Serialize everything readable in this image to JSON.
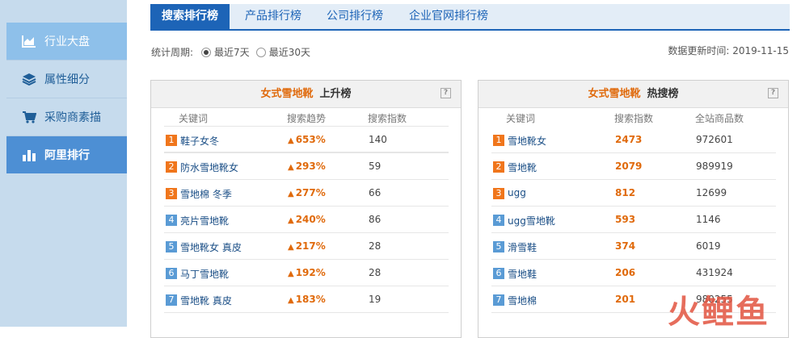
{
  "sidebar": {
    "items": [
      {
        "label": "行业大盘",
        "icon": "chart-area-icon"
      },
      {
        "label": "属性细分",
        "icon": "layers-icon"
      },
      {
        "label": "采购商素描",
        "icon": "cart-icon"
      },
      {
        "label": "阿里排行",
        "icon": "bar-chart-icon"
      }
    ]
  },
  "tabs": [
    "搜索排行榜",
    "产品排行榜",
    "公司排行榜",
    "企业官网排行榜"
  ],
  "period": {
    "label": "统计周期:",
    "options": [
      "最近7天",
      "最近30天"
    ],
    "selected": "最近7天"
  },
  "update": {
    "label": "数据更新时间:",
    "date": "2019-11-15"
  },
  "rising": {
    "category": "女式雪地靴",
    "title": "上升榜",
    "columns": [
      "关键词",
      "搜索趋势",
      "搜索指数"
    ],
    "rows": [
      {
        "rank": "1",
        "keyword": "鞋子女冬",
        "trend": "653%",
        "index": "140"
      },
      {
        "rank": "2",
        "keyword": "防水雪地靴女",
        "trend": "293%",
        "index": "59"
      },
      {
        "rank": "3",
        "keyword": "雪地棉 冬季",
        "trend": "277%",
        "index": "66"
      },
      {
        "rank": "4",
        "keyword": "亮片雪地靴",
        "trend": "240%",
        "index": "86"
      },
      {
        "rank": "5",
        "keyword": "雪地靴女 真皮",
        "trend": "217%",
        "index": "28"
      },
      {
        "rank": "6",
        "keyword": "马丁雪地靴",
        "trend": "192%",
        "index": "28"
      },
      {
        "rank": "7",
        "keyword": "雪地靴 真皮",
        "trend": "183%",
        "index": "19"
      }
    ]
  },
  "hot": {
    "category": "女式雪地靴",
    "title": "热搜榜",
    "columns": [
      "关键词",
      "搜索指数",
      "全站商品数"
    ],
    "rows": [
      {
        "rank": "1",
        "keyword": "雪地靴女",
        "index": "2473",
        "count": "972601"
      },
      {
        "rank": "2",
        "keyword": "雪地靴",
        "index": "2079",
        "count": "989919"
      },
      {
        "rank": "3",
        "keyword": "ugg",
        "index": "812",
        "count": "12699"
      },
      {
        "rank": "4",
        "keyword": "ugg雪地靴",
        "index": "593",
        "count": "1146"
      },
      {
        "rank": "5",
        "keyword": "滑雪鞋",
        "index": "374",
        "count": "6019"
      },
      {
        "rank": "6",
        "keyword": "雪地鞋",
        "index": "206",
        "count": "431924"
      },
      {
        "rank": "7",
        "keyword": "雪地棉",
        "index": "201",
        "count": "980255"
      }
    ]
  },
  "rank_colors": {
    "top3": "#f0761c",
    "rest": "#5a9bd5"
  },
  "watermark": "火鲤鱼"
}
